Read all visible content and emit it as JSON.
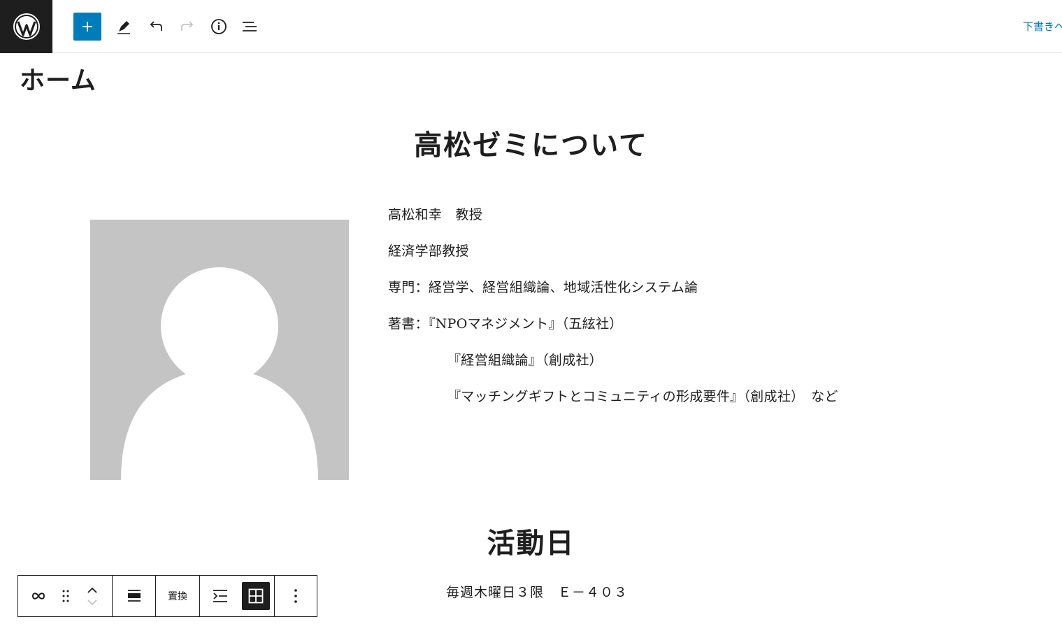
{
  "toolbar": {
    "logo_icon": "wordpress-icon",
    "add_icon": "plus-icon",
    "tools_icon": "pencil-icon",
    "undo_icon": "undo-icon",
    "redo_icon": "redo-icon",
    "details_icon": "info-icon",
    "list_view_icon": "list-view-icon",
    "draft_label": "下書きへ",
    "accent": "#007cba"
  },
  "page": {
    "title": "ホーム"
  },
  "about": {
    "heading": "高松ゼミについて",
    "avatar_icon": "person-placeholder-icon",
    "lines": [
      "高松和幸　教授",
      "経済学部教授",
      "専門：経営学、経営組織論、地域活性化システム論",
      "著書：『NPOマネジメント』（五絃社）",
      "『経営組織論』（創成社）",
      "『マッチングギフトとコミュニティの形成要件』（創成社）　など"
    ]
  },
  "activity": {
    "heading": "活動日",
    "schedule": "毎週木曜日３限　Ｅ－４０３"
  },
  "block_toolbar": {
    "link_icon": "link-icon",
    "drag_icon": "drag-handle-icon",
    "move_up_icon": "chevron-up-icon",
    "move_down_icon": "chevron-down-icon",
    "align_icon": "align-center-icon",
    "replace_label": "置換",
    "media_text_icon": "media-text-icon",
    "grid_icon": "grid-icon",
    "more_icon": "more-vertical-icon"
  }
}
